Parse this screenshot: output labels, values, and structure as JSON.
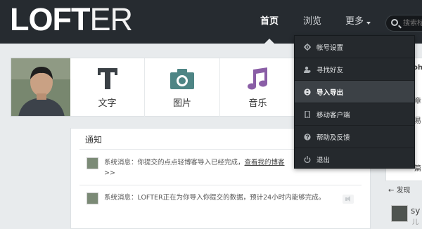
{
  "header": {
    "logo_bold": "LOFT",
    "logo_thin": "ER",
    "nav": [
      {
        "label": "首页",
        "active": true
      },
      {
        "label": "浏览",
        "active": false
      },
      {
        "label": "更多",
        "active": false
      }
    ],
    "search_placeholder": "搜索标"
  },
  "post_types": [
    {
      "label": "文字",
      "icon": "text-icon"
    },
    {
      "label": "图片",
      "icon": "camera-icon"
    },
    {
      "label": "音乐",
      "icon": "music-icon"
    }
  ],
  "notice": {
    "title": "通知",
    "messages": [
      {
        "prefix": "系统消息：你提交的点点轻博客导入已经完成，",
        "link": "查看我的博客",
        "suffix": ">>"
      },
      {
        "text": "系统消息：LOFTER正在为你导入你提交的数据，预计24小时内能够完成。"
      }
    ]
  },
  "more_menu": {
    "items": [
      {
        "label": "帐号设置",
        "icon": "gear-icon"
      },
      {
        "label": "寻找好友",
        "icon": "find-friends-icon"
      },
      {
        "label": "导入导出",
        "icon": "import-export-icon",
        "hovered": true
      },
      {
        "label": "移动客户端",
        "icon": "mobile-icon"
      },
      {
        "label": "帮助及反馈",
        "icon": "help-icon"
      },
      {
        "label": "退出",
        "icon": "power-icon"
      }
    ]
  },
  "right_col": {
    "text_1": "oh",
    "text_2": "章",
    "text_3": "易",
    "text_4": "篇",
    "text_5": "发现",
    "user_name": "sy",
    "user_sub": "儿"
  },
  "colors": {
    "topbar": "#262b30",
    "teal": "#4e8585",
    "purple": "#8a5ea6",
    "dark_slate": "#3a4045"
  }
}
